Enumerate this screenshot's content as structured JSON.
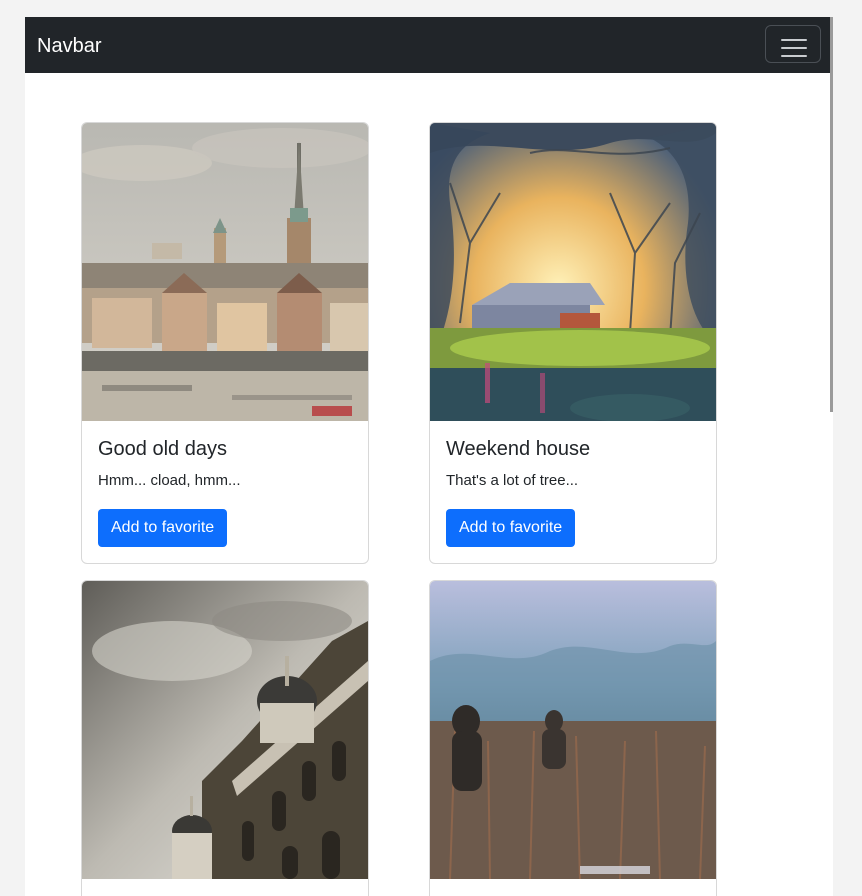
{
  "navbar": {
    "brand": "Navbar",
    "toggler_icon": "hamburger-icon"
  },
  "colors": {
    "navbar_bg": "#212529",
    "button_primary": "#0d6efd",
    "page_bg": "#f3f3f3"
  },
  "cards": [
    {
      "title": "Good old days",
      "text": "Hmm... cload, hmm...",
      "button": "Add to favorite",
      "image": "city-skyline-photo"
    },
    {
      "title": "Weekend house",
      "text": "That's a lot of tree...",
      "button": "Add to favorite",
      "image": "tree-alley-house-photo"
    },
    {
      "title": "",
      "text": "",
      "button": "",
      "image": "baroque-building-photo"
    },
    {
      "title": "",
      "text": "",
      "button": "",
      "image": "foggy-field-figures-photo"
    }
  ]
}
